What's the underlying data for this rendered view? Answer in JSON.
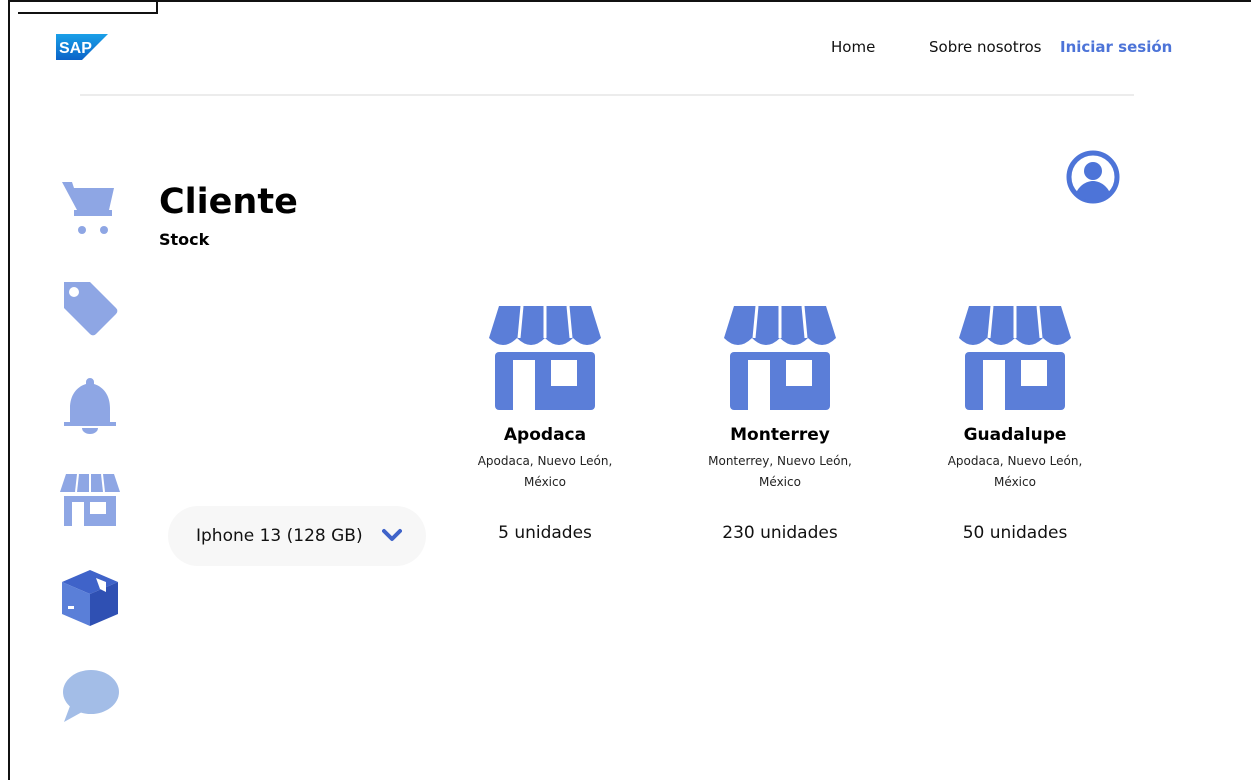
{
  "header": {
    "logo_text": "SAP",
    "nav": {
      "home": "Home",
      "about": "Sobre nosotros",
      "login": "Iniciar sesión"
    }
  },
  "sidebar": {
    "icons": [
      "cart-icon",
      "tag-icon",
      "bell-icon",
      "store-icon",
      "box-icon",
      "chat-icon"
    ]
  },
  "page": {
    "title": "Cliente",
    "subtitle": "Stock"
  },
  "product_select": {
    "value": "Iphone 13 (128 GB)"
  },
  "stores": [
    {
      "name": "Apodaca",
      "address": "Apodaca, Nuevo León, México",
      "stock": "5 unidades"
    },
    {
      "name": "Monterrey",
      "address": "Monterrey, Nuevo León, México",
      "stock": "230 unidades"
    },
    {
      "name": "Guadalupe",
      "address": "Apodaca, Nuevo León, México",
      "stock": "50 unidades"
    }
  ],
  "colors": {
    "accent": "#4d74d8",
    "icon_light": "#8ea6e4",
    "icon_mid": "#5a7fd8",
    "store": "#5b7ed8",
    "chat": "#a3bde7"
  }
}
